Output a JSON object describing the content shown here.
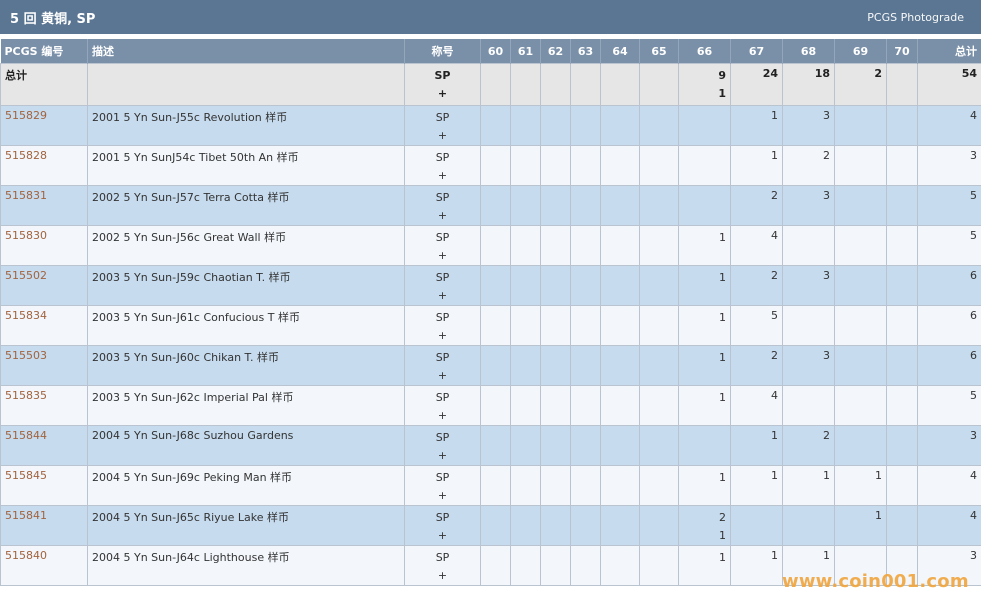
{
  "header": {
    "title": "5 回 黄铜, SP",
    "link": "PCGS Photograde"
  },
  "columns": {
    "pcgs_no": "PCGS 编号",
    "desc": "描述",
    "designation": "称号",
    "g60": "60",
    "g61": "61",
    "g62": "62",
    "g63": "63",
    "g64": "64",
    "g65": "65",
    "g66": "66",
    "g67": "67",
    "g68": "68",
    "g69": "69",
    "g70": "70",
    "total": "总计"
  },
  "total_row": {
    "label": "总计",
    "desig_1": "SP",
    "desig_2": "+",
    "g66_1": "9",
    "g66_2": "1",
    "g67": "24",
    "g68": "18",
    "g69": "2",
    "total": "54"
  },
  "rows": [
    {
      "id": "515829",
      "desc": "2001 5 Yn Sun-J55c Revolution 样币",
      "desig_1": "SP",
      "desig_2": "+",
      "g66_1": "",
      "g66_2": "",
      "g67": "1",
      "g68": "3",
      "g69": "",
      "total": "4"
    },
    {
      "id": "515828",
      "desc": "2001 5 Yn SunJ54c Tibet 50th An 样币",
      "desig_1": "SP",
      "desig_2": "+",
      "g66_1": "",
      "g66_2": "",
      "g67": "1",
      "g68": "2",
      "g69": "",
      "total": "3"
    },
    {
      "id": "515831",
      "desc": "2002 5 Yn Sun-J57c Terra Cotta 样币",
      "desig_1": "SP",
      "desig_2": "+",
      "g66_1": "",
      "g66_2": "",
      "g67": "2",
      "g68": "3",
      "g69": "",
      "total": "5"
    },
    {
      "id": "515830",
      "desc": "2002 5 Yn Sun-J56c Great Wall 样币",
      "desig_1": "SP",
      "desig_2": "+",
      "g66_1": "1",
      "g66_2": "",
      "g67": "4",
      "g68": "",
      "g69": "",
      "total": "5"
    },
    {
      "id": "515502",
      "desc": "2003 5 Yn Sun-J59c Chaotian T. 样币",
      "desig_1": "SP",
      "desig_2": "+",
      "g66_1": "1",
      "g66_2": "",
      "g67": "2",
      "g68": "3",
      "g69": "",
      "total": "6"
    },
    {
      "id": "515834",
      "desc": "2003 5 Yn Sun-J61c Confucious T 样币",
      "desig_1": "SP",
      "desig_2": "+",
      "g66_1": "1",
      "g66_2": "",
      "g67": "5",
      "g68": "",
      "g69": "",
      "total": "6"
    },
    {
      "id": "515503",
      "desc": "2003 5 Yn Sun-J60c Chikan T. 样币",
      "desig_1": "SP",
      "desig_2": "+",
      "g66_1": "1",
      "g66_2": "",
      "g67": "2",
      "g68": "3",
      "g69": "",
      "total": "6"
    },
    {
      "id": "515835",
      "desc": "2003 5 Yn Sun-J62c Imperial Pal 样币",
      "desig_1": "SP",
      "desig_2": "+",
      "g66_1": "1",
      "g66_2": "",
      "g67": "4",
      "g68": "",
      "g69": "",
      "total": "5"
    },
    {
      "id": "515844",
      "desc": "2004 5 Yn Sun-J68c Suzhou Gardens",
      "desig_1": "SP",
      "desig_2": "+",
      "g66_1": "",
      "g66_2": "",
      "g67": "1",
      "g68": "2",
      "g69": "",
      "total": "3"
    },
    {
      "id": "515845",
      "desc": "2004 5 Yn Sun-J69c Peking Man 样币",
      "desig_1": "SP",
      "desig_2": "+",
      "g66_1": "1",
      "g66_2": "",
      "g67": "1",
      "g68": "1",
      "g69": "1",
      "total": "4"
    },
    {
      "id": "515841",
      "desc": "2004 5 Yn Sun-J65c Riyue Lake 样币",
      "desig_1": "SP",
      "desig_2": "+",
      "g66_1": "2",
      "g66_2": "1",
      "g67": "",
      "g68": "",
      "g69": "1",
      "total": "4"
    },
    {
      "id": "515840",
      "desc": "2004 5 Yn Sun-J64c Lighthouse 样币",
      "desig_1": "SP",
      "desig_2": "+",
      "g66_1": "1",
      "g66_2": "",
      "g67": "1",
      "g68": "1",
      "g69": "",
      "total": "3"
    }
  ],
  "watermark": "www.coin001.com"
}
